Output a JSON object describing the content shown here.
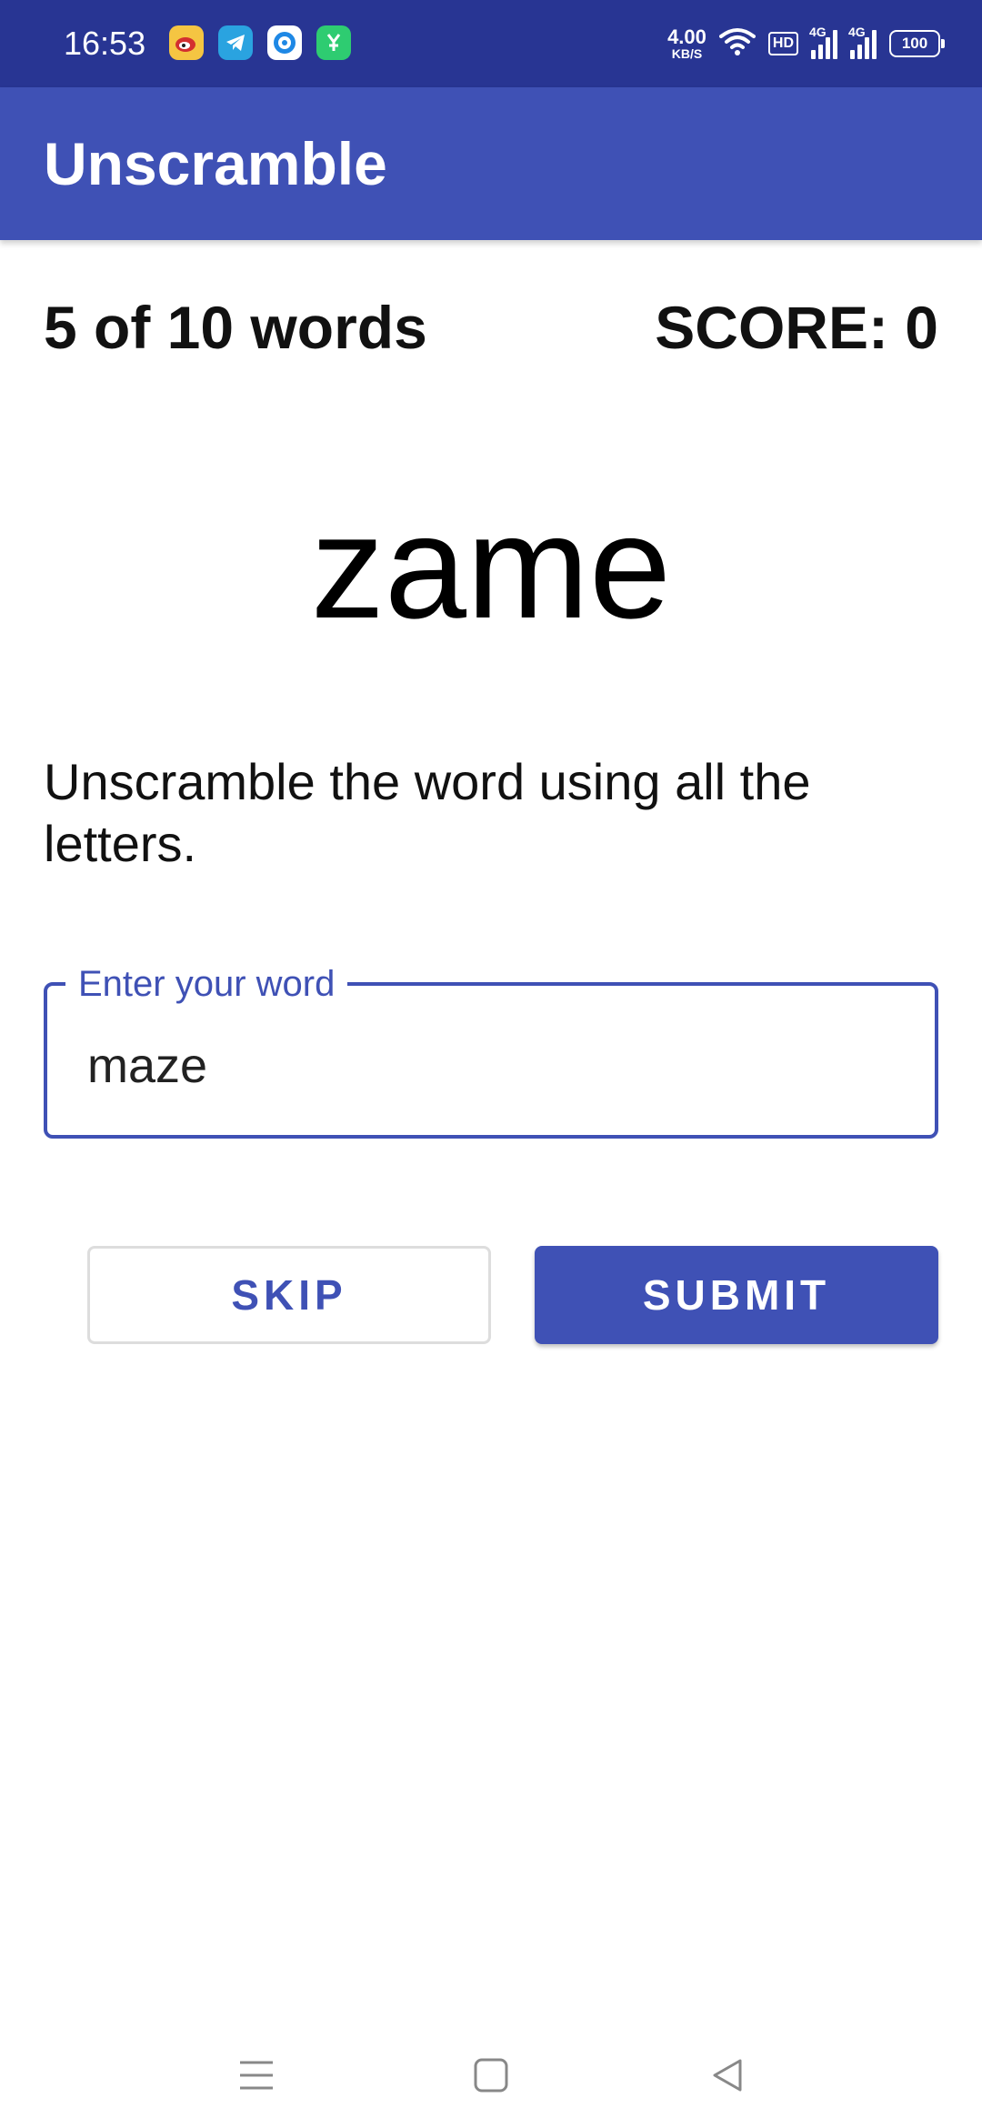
{
  "status_bar": {
    "time": "16:53",
    "net_speed_value": "4.00",
    "net_speed_unit": "KB/S",
    "hd_label": "HD",
    "signal_1_label": "4G",
    "signal_2_label": "4G",
    "battery_level": "100",
    "app_icons": [
      "weibo-icon",
      "telegram-icon",
      "browser-icon",
      "green-app-icon"
    ]
  },
  "app_bar": {
    "title": "Unscramble"
  },
  "game": {
    "word_count": "5 of 10 words",
    "score": "SCORE: 0",
    "scrambled_word": "zame",
    "instructions": "Unscramble the word using all the letters."
  },
  "input": {
    "label": "Enter your word",
    "value": "maze"
  },
  "buttons": {
    "skip_label": "SKIP",
    "submit_label": "SUBMIT"
  },
  "nav_bar": {
    "icons": [
      "menu-icon",
      "home-icon",
      "back-icon"
    ]
  },
  "colors": {
    "status_bar": "#283593",
    "primary": "#3f51b5"
  }
}
